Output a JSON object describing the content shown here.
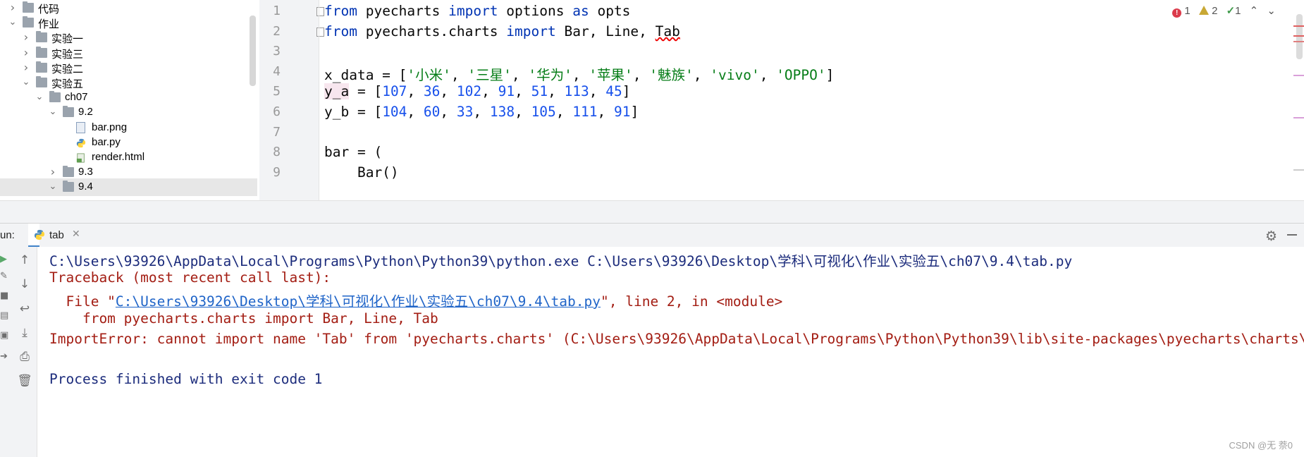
{
  "tree": {
    "rows": [
      {
        "label": "代码",
        "chevron": "›",
        "type": "folder",
        "indent": 0
      },
      {
        "label": "作业",
        "chevron": "⌄",
        "type": "folder",
        "indent": 0
      },
      {
        "label": "实验一",
        "chevron": "›",
        "type": "folder",
        "indent": 1
      },
      {
        "label": "实验三",
        "chevron": "›",
        "type": "folder",
        "indent": 1
      },
      {
        "label": "实验二",
        "chevron": "›",
        "type": "folder",
        "indent": 1
      },
      {
        "label": "实验五",
        "chevron": "⌄",
        "type": "folder",
        "indent": 1
      },
      {
        "label": "ch07",
        "chevron": "⌄",
        "type": "folder",
        "indent": 2
      },
      {
        "label": "9.2",
        "chevron": "⌄",
        "type": "folder",
        "indent": 3
      },
      {
        "label": "bar.png",
        "chevron": "",
        "type": "png",
        "indent": 4
      },
      {
        "label": "bar.py",
        "chevron": "",
        "type": "py",
        "indent": 4
      },
      {
        "label": "render.html",
        "chevron": "",
        "type": "html",
        "indent": 4
      },
      {
        "label": "9.3",
        "chevron": "›",
        "type": "folder",
        "indent": 3
      },
      {
        "label": "9.4",
        "chevron": "⌄",
        "type": "folder",
        "indent": 3
      }
    ]
  },
  "editor": {
    "line_numbers": [
      "1",
      "2",
      "3",
      "4",
      "5",
      "6",
      "7",
      "8",
      "9"
    ],
    "code": {
      "l1": {
        "kw1": "from",
        "t1": " pyecharts ",
        "kw2": "import",
        "t2": " options ",
        "kw3": "as",
        "t3": " opts"
      },
      "l2": {
        "kw1": "from",
        "t1": " pyecharts.charts ",
        "kw2": "import",
        "t2": " Bar, Line, ",
        "t3": "Tab"
      },
      "l4": {
        "t1": "x_data = [",
        "s1": "'小米'",
        "c1": ", ",
        "s2": "'三星'",
        "c2": ", ",
        "s3": "'华为'",
        "c3": ", ",
        "s4": "'苹果'",
        "c4": ", ",
        "s5": "'魅族'",
        "c5": ", ",
        "s6": "'vivo'",
        "c6": ", ",
        "s7": "'OPPO'",
        "t2": "]"
      },
      "l5": {
        "v": "y_a",
        "t1": " = [",
        "n1": "107",
        "c1": ", ",
        "n2": "36",
        "c2": ", ",
        "n3": "102",
        "c3": ", ",
        "n4": "91",
        "c4": ", ",
        "n5": "51",
        "c5": ", ",
        "n6": "113",
        "c6": ", ",
        "n7": "45",
        "t2": "]"
      },
      "l6": {
        "t1": "y_b = [",
        "n1": "104",
        "c1": ", ",
        "n2": "60",
        "c2": ", ",
        "n3": "33",
        "c3": ", ",
        "n4": "138",
        "c4": ", ",
        "n5": "105",
        "c5": ", ",
        "n6": "111",
        "c6": ", ",
        "n7": "91",
        "t2": "]"
      },
      "l8": {
        "t1": "bar = ("
      },
      "l9": {
        "t1": "    Bar()"
      }
    },
    "inspections": {
      "errors": "1",
      "warnings": "2",
      "ok": "1"
    }
  },
  "run": {
    "label": "un:",
    "tab_label": "tab",
    "console": {
      "cmd": "C:\\Users\\93926\\AppData\\Local\\Programs\\Python\\Python39\\python.exe C:\\Users\\93926\\Desktop\\学科\\可视化\\作业\\实验五\\ch07\\9.4\\tab.py",
      "traceback": "Traceback (most recent call last):",
      "file_prefix": "  File \"",
      "file_link": "C:\\Users\\93926\\Desktop\\学科\\可视化\\作业\\实验五\\ch07\\9.4\\tab.py",
      "file_suffix": "\", line 2, in <module>",
      "source": "    from pyecharts.charts import Bar, Line, Tab",
      "error": "ImportError: cannot import name 'Tab' from 'pyecharts.charts' (C:\\Users\\93926\\AppData\\Local\\Programs\\Python\\Python39\\lib\\site-packages\\pyecharts\\charts\\__init__.py)",
      "exit": "Process finished with exit code 1"
    }
  },
  "watermark": "CSDN @无 萘0",
  "colors": {
    "keyword": "#0033b3",
    "string": "#067d17",
    "number": "#1750eb",
    "error": "#a31d13",
    "link": "#1f64c8"
  }
}
